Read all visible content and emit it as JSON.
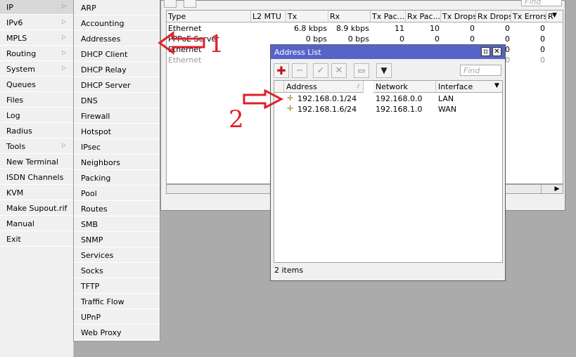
{
  "left_menu": {
    "items": [
      {
        "label": "IP",
        "arrow": true,
        "selected": true
      },
      {
        "label": "IPv6",
        "arrow": true
      },
      {
        "label": "MPLS",
        "arrow": true
      },
      {
        "label": "Routing",
        "arrow": true
      },
      {
        "label": "System",
        "arrow": true
      },
      {
        "label": "Queues"
      },
      {
        "label": "Files"
      },
      {
        "label": "Log"
      },
      {
        "label": "Radius"
      },
      {
        "label": "Tools",
        "arrow": true
      },
      {
        "label": "New Terminal"
      },
      {
        "label": "ISDN Channels"
      },
      {
        "label": "KVM"
      },
      {
        "label": "Make Supout.rif"
      },
      {
        "label": "Manual"
      },
      {
        "label": "Exit"
      }
    ]
  },
  "ip_submenu": {
    "items": [
      "ARP",
      "Accounting",
      "Addresses",
      "DHCP Client",
      "DHCP Relay",
      "DHCP Server",
      "DNS",
      "Firewall",
      "Hotspot",
      "IPsec",
      "Neighbors",
      "Packing",
      "Pool",
      "Routes",
      "SMB",
      "SNMP",
      "Services",
      "Socks",
      "TFTP",
      "Traffic Flow",
      "UPnP",
      "Web Proxy"
    ]
  },
  "interface_window": {
    "find_placeholder": "Find",
    "columns": [
      "Type",
      "L2 MTU",
      "Tx",
      "Rx",
      "Tx Pac...",
      "Rx Pac...",
      "Tx Drops",
      "Rx Drops",
      "Tx Errors",
      "R"
    ],
    "rows": [
      {
        "type": "Ethernet",
        "l2mtu": "",
        "tx": "6.8 kbps",
        "rx": "8.9 kbps",
        "txpac": "11",
        "rxpac": "10",
        "txdrops": "0",
        "rxdrops": "0",
        "txerr": "0"
      },
      {
        "type": "PPPoE Server",
        "l2mtu": "",
        "tx": "0 bps",
        "rx": "0 bps",
        "txpac": "0",
        "rxpac": "0",
        "txdrops": "0",
        "rxdrops": "0",
        "txerr": "0"
      },
      {
        "type": "Ethernet",
        "l2mtu": "",
        "tx": "",
        "rx": "",
        "txpac": "",
        "rxpac": "",
        "txdrops": "",
        "rxdrops": "0",
        "txerr": "0"
      },
      {
        "type": "Ethernet",
        "l2mtu": "",
        "tx": "",
        "rx": "",
        "txpac": "",
        "rxpac": "",
        "txdrops": "",
        "rxdrops": "0",
        "txerr": "0",
        "disabled": true
      }
    ]
  },
  "address_list": {
    "title": "Address List",
    "find_placeholder": "Find",
    "columns": [
      "Address",
      "Network",
      "Interface"
    ],
    "rows": [
      {
        "address": "192.168.0.1/24",
        "network": "192.168.0.0",
        "interface": "LAN"
      },
      {
        "address": "192.168.1.6/24",
        "network": "192.168.1.0",
        "interface": "WAN"
      }
    ],
    "status": "2 items"
  },
  "annotations": {
    "one": "1",
    "two": "2"
  },
  "colors": {
    "title_bar": "#5664c8",
    "annotation": "#e0202a",
    "add_icon": "#cc1111"
  }
}
